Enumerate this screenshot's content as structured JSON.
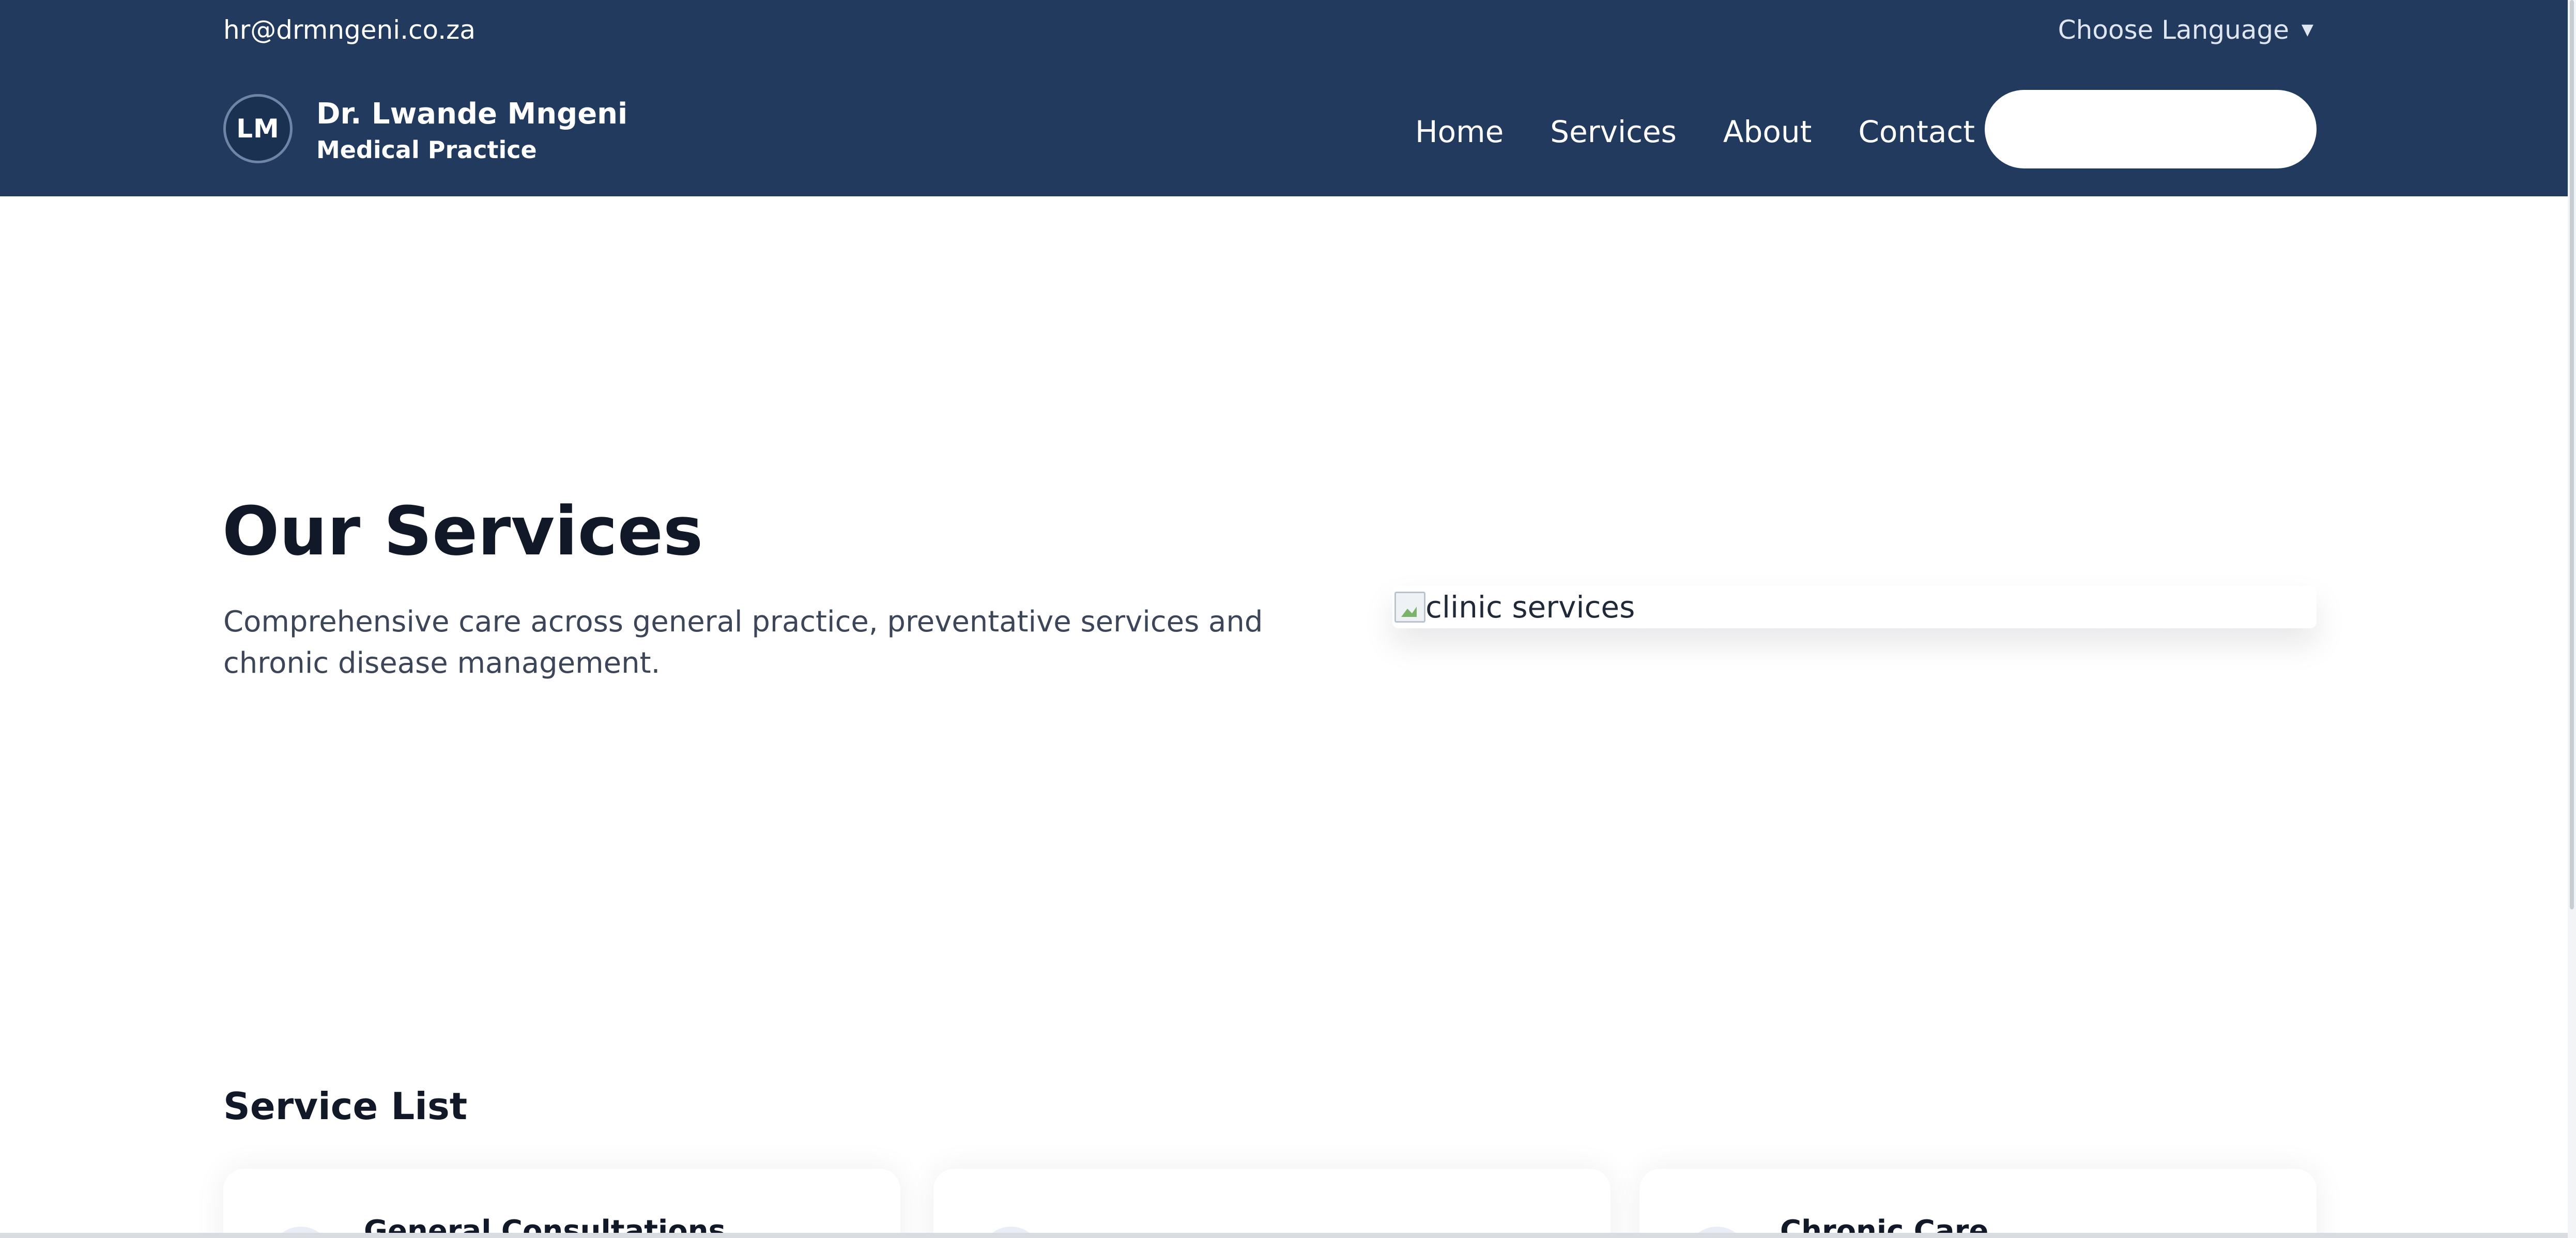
{
  "topbar": {
    "email": "hr@drmngeni.co.za",
    "language_label": "Choose Language",
    "language_caret": "▼"
  },
  "brand": {
    "initials": "LM",
    "name": "Dr. Lwande Mngeni",
    "subtitle": "Medical Practice"
  },
  "nav": {
    "items": [
      "Home",
      "Services",
      "About",
      "Contact"
    ],
    "cta_label": ""
  },
  "hero": {
    "title": "Our Services",
    "description": "Comprehensive care across general practice, preventative services and chronic disease management.",
    "image_alt": "clinic services"
  },
  "services": {
    "title": "Service List",
    "cards": [
      {
        "title": "General Consultations"
      },
      {
        "title": ""
      },
      {
        "title": "Chronic Care"
      }
    ]
  },
  "colors": {
    "header_bg": "#213a5e",
    "heading": "#111827",
    "body_text": "#3c4658"
  }
}
